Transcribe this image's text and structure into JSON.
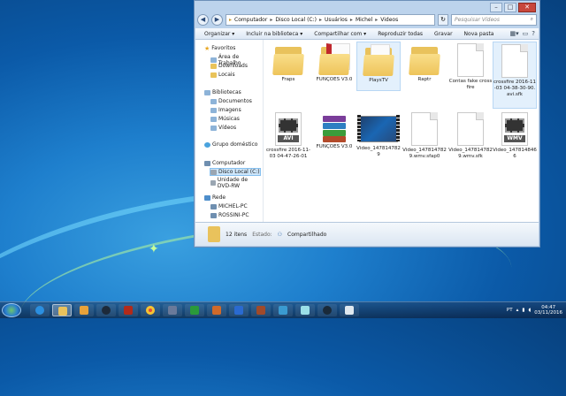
{
  "window": {
    "address": [
      "Computador",
      "Disco Local (C:)",
      "Usuários",
      "Michel",
      "Videos"
    ],
    "search_placeholder": "Pesquisar Vídeos",
    "toolbar": [
      "Organizar ▾",
      "Incluir na biblioteca ▾",
      "Compartilhar com ▾",
      "Reproduzir todas",
      "Gravar",
      "Nova pasta"
    ],
    "nav": {
      "favorites": {
        "header": "Favoritos",
        "items": [
          "Área de Trabalho",
          "Downloads",
          "Locais"
        ]
      },
      "libraries": {
        "header": "Bibliotecas",
        "items": [
          "Documentos",
          "Imagens",
          "Músicas",
          "Vídeos"
        ]
      },
      "homegroup": "Grupo doméstico",
      "computer": {
        "header": "Computador",
        "items": [
          "Disco Local (C:)",
          "Unidade de DVD-RW"
        ]
      },
      "network": {
        "header": "Rede",
        "items": [
          "MICHEL-PC",
          "ROSSINI-PC"
        ]
      }
    },
    "files": [
      {
        "name": "Fraps",
        "type": "folder"
      },
      {
        "name": "FUNÇOES V3.0",
        "type": "folder"
      },
      {
        "name": "PlaysTV",
        "type": "folder"
      },
      {
        "name": "Raptr",
        "type": "folder"
      },
      {
        "name": "Contas fake crossfire",
        "type": "doc"
      },
      {
        "name": "crossfire 2016-11-03 04-38-30-90.avi.sfk",
        "type": "doc"
      },
      {
        "name": "crossfire 2016-11-03 04-47-26-01",
        "type": "avi",
        "tag": "AVI"
      },
      {
        "name": "FUNÇOES V3.0",
        "type": "rar"
      },
      {
        "name": "Video_1478147829",
        "type": "video"
      },
      {
        "name": "Video_147814782 9.wmv.sfap0",
        "type": "doc"
      },
      {
        "name": "Video_147814782 9.wmv.sfk",
        "type": "doc"
      },
      {
        "name": "Video_147814846 6",
        "type": "wmv",
        "tag": "WMV"
      }
    ],
    "status": {
      "count": "12 itens",
      "state_label": "Estado:",
      "state_value": "Compartilhado"
    }
  },
  "taskbar": {
    "lang": "PT",
    "time": "04:47",
    "date": "03/11/2016"
  }
}
